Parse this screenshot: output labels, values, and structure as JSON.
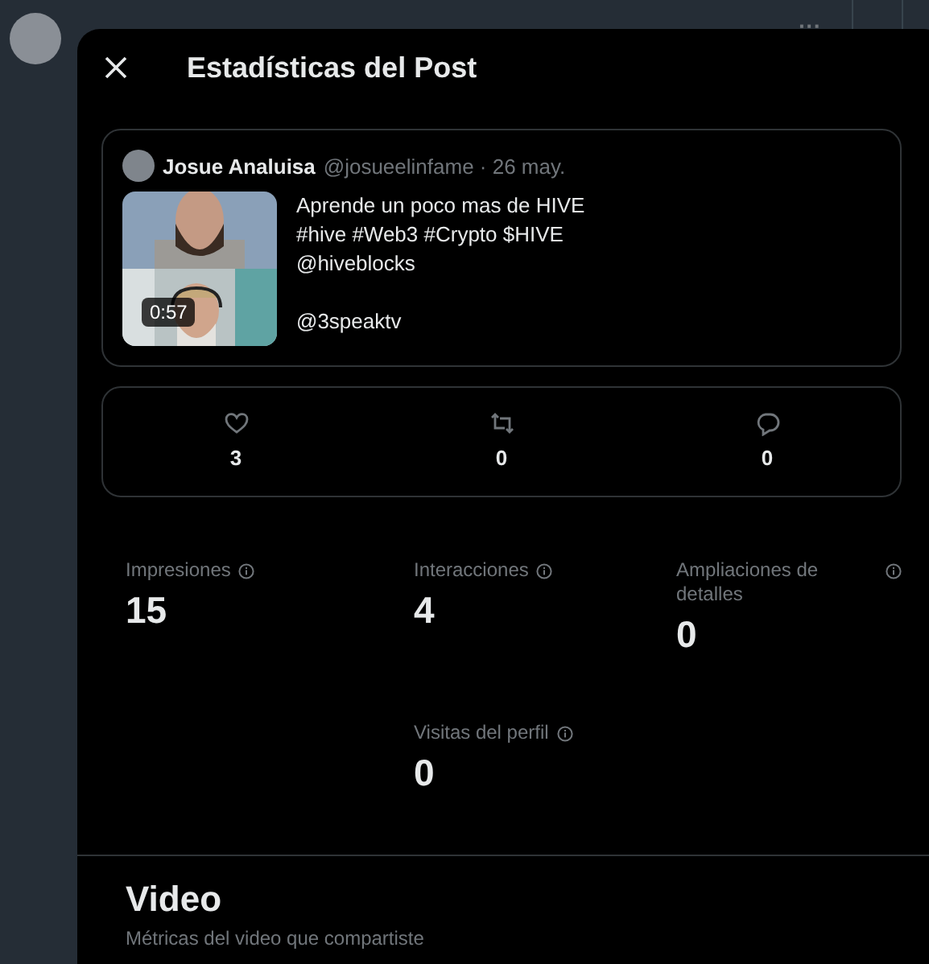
{
  "background_post": {
    "menu": "···"
  },
  "modal": {
    "title": "Estadísticas del Post",
    "post": {
      "author": "Josue Analuisa",
      "handle_date": "@josueelinfame · 26 may.",
      "media": {
        "kind": "picture",
        "duration": "0:57"
      },
      "paragraphs": [
        [
          "Aprende un poco mas de HIVE",
          "#hive #Web3 #Crypto $HIVE",
          "@hiveblocks"
        ],
        [
          "@3speaktv"
        ]
      ]
    },
    "engagement": [
      {
        "kind": "like",
        "count": "3"
      },
      {
        "kind": "repost",
        "count": "0"
      },
      {
        "kind": "reply",
        "count": "0"
      }
    ],
    "metrics": [
      {
        "label": "Impresiones",
        "value": "15"
      },
      {
        "label": "Interacciones",
        "value": "4"
      },
      {
        "label": "Ampliaciones de detalles",
        "value": "0"
      },
      {
        "label": "Visitas del perfil",
        "value": "0"
      }
    ],
    "section": {
      "title": "Video",
      "subtitle": "Métricas del video que compartiste"
    }
  }
}
